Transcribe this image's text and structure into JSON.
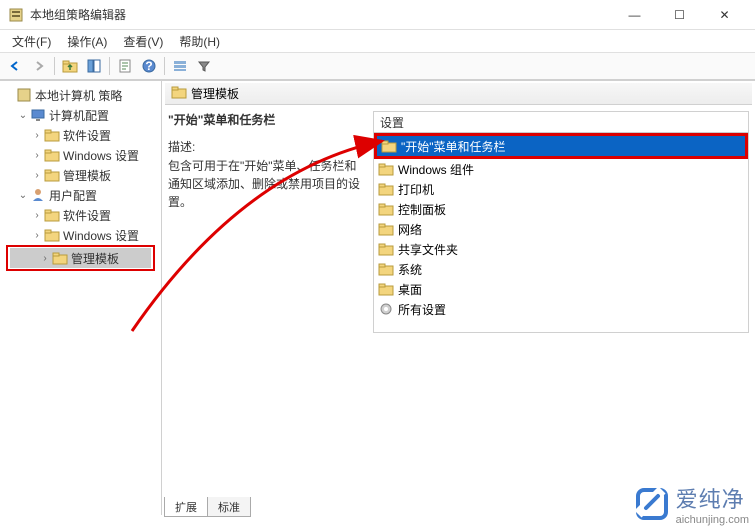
{
  "window": {
    "title": "本地组策略编辑器",
    "controls": {
      "min": "—",
      "max": "☐",
      "close": "✕"
    }
  },
  "menu": {
    "file": "文件(F)",
    "action": "操作(A)",
    "view": "查看(V)",
    "help": "帮助(H)"
  },
  "tree": {
    "root": "本地计算机 策略",
    "computer": "计算机配置",
    "user": "用户配置",
    "software": "软件设置",
    "windows": "Windows 设置",
    "templates": "管理模板"
  },
  "content": {
    "header": "管理模板",
    "section_title": "\"开始\"菜单和任务栏",
    "desc_label": "描述:",
    "desc_text": "包含可用于在\"开始\"菜单、任务栏和通知区域添加、删除或禁用项目的设置。",
    "list_header": "设置",
    "items": [
      "\"开始\"菜单和任务栏",
      "Windows 组件",
      "打印机",
      "控制面板",
      "网络",
      "共享文件夹",
      "系统",
      "桌面",
      "所有设置"
    ],
    "tabs": {
      "extended": "扩展",
      "standard": "标准"
    }
  },
  "watermark": {
    "cn": "爱纯净",
    "en": "aichunjing.com"
  }
}
